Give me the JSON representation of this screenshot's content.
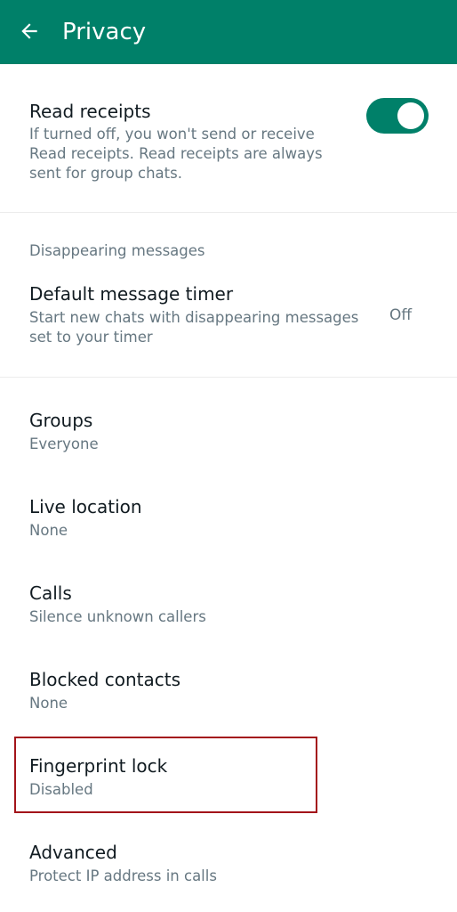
{
  "app_bar": {
    "title": "Privacy",
    "back_icon": "arrow-left-icon",
    "background_color": "#008069"
  },
  "read_receipts": {
    "title": "Read receipts",
    "description_lines": [
      "If turned off, you won't send or receive",
      "Read receipts. Read receipts are always",
      "sent for group chats."
    ],
    "toggle_on": true,
    "toggle_color": "#008069"
  },
  "disappearing": {
    "section_header": "Disappearing messages",
    "title": "Default message timer",
    "description_lines": [
      "Start new chats with disappearing messages",
      "set to your timer"
    ],
    "value": "Off"
  },
  "items": [
    {
      "title": "Groups",
      "subtitle": "Everyone"
    },
    {
      "title": "Live location",
      "subtitle": "None"
    },
    {
      "title": "Calls",
      "subtitle": "Silence unknown callers"
    },
    {
      "title": "Blocked contacts",
      "subtitle": "None"
    },
    {
      "title": "Fingerprint lock",
      "subtitle": "Disabled"
    },
    {
      "title": "Advanced",
      "subtitle": "Protect IP address in calls"
    }
  ],
  "highlight_color": "#a3141a"
}
